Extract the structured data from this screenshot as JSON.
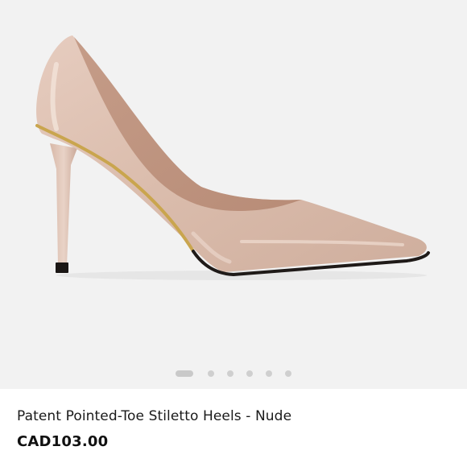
{
  "product": {
    "title": "Patent Pointed-Toe Stiletto Heels - Nude",
    "price": "CAD103.00",
    "colors": {
      "shoe": "#dcbfb0",
      "gold_trim": "#c9a54e",
      "sole": "#1f1a18",
      "gallery_background": "#f2f2f2"
    }
  },
  "gallery": {
    "image_count": 6,
    "active_index": 0
  }
}
